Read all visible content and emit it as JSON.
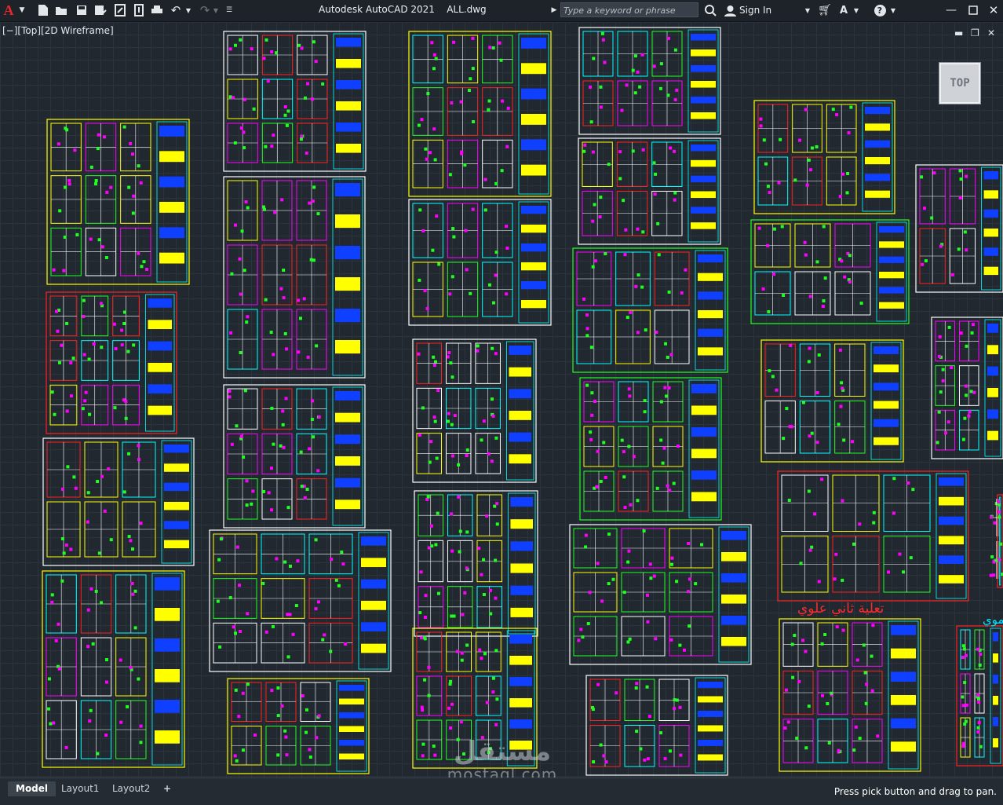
{
  "app": {
    "title": "Autodesk AutoCAD 2021",
    "file": "ALL.dwg",
    "logo": "A",
    "search_placeholder": "Type a keyword or phrase",
    "sign_in": "Sign In",
    "help": "?"
  },
  "viewport": {
    "label": "[−][Top][2D Wireframe]",
    "navcube": "TOP",
    "background": "#212830"
  },
  "annotations": {
    "red_title": "تعلية ثاني علوي",
    "cyan_fragment": "موي"
  },
  "tabs": [
    {
      "label": "Model",
      "active": true
    },
    {
      "label": "Layout1",
      "active": false
    },
    {
      "label": "Layout2",
      "active": false
    },
    {
      "label": "+",
      "active": false
    }
  ],
  "status": {
    "message": "Press pick button and drag to pan."
  },
  "watermark": {
    "logo": "مستقل",
    "text": "mostaql.com"
  },
  "colors": {
    "accent_red": "#e8262b",
    "sheet_yellow": "#ffff00",
    "sheet_white": "#ffffff",
    "sheet_green": "#20ff20",
    "sheet_red": "#ff2020"
  }
}
